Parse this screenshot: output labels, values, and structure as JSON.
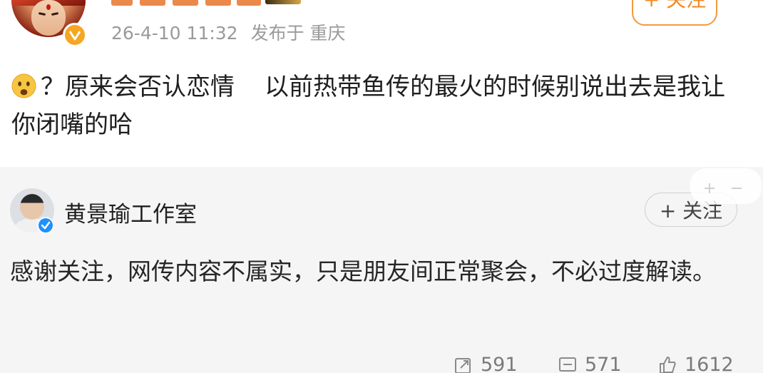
{
  "post": {
    "meta_time": "26-4-10 11:32",
    "meta_location": "发布于 重庆",
    "follow_label": "+ 关注",
    "text_part1": "？原来会否认恋情",
    "text_part2": "以前热带鱼传的最火的时候别说出去是我让你闭嘴的哈",
    "emoji": "frowning-face-icon"
  },
  "reply": {
    "author": "黄景瑜工作室",
    "follow_label": "+ 关注",
    "text": "感谢关注，网传内容不属实，只是朋友间正常聚会，不必过度解读。",
    "actions": {
      "repost_count": "591",
      "comment_count": "571",
      "like_count": "1612"
    }
  },
  "colors": {
    "accent_orange": "#f08a24",
    "card_bg": "#f5f5f5",
    "meta_gray": "#9a9a9a",
    "verified_gold": "#f5a623",
    "verified_blue": "#1e90ff"
  }
}
